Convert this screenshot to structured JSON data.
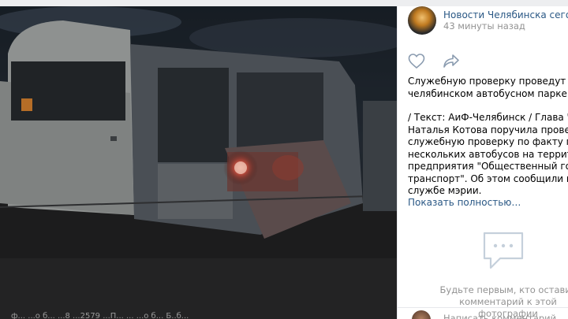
{
  "post": {
    "group_name": "Новости Челябинска сегодня,",
    "time": "43 минуты назад",
    "text_lines": [
      "Служебную проверку проведут из-за Ч",
      "челябинском автобусном парке",
      "",
      "/ Текст: АиФ-Челябинск / Глава Челябі",
      "Наталья Котова поручила провести",
      "служебную проверку по факту поврежд",
      "нескольких автобусов на территории",
      "предприятия \"Общественный городско",
      "транспорт\". Об этом сообщили в пресс",
      "службе мэрии."
    ],
    "show_more": "Показать полностью…"
  },
  "actions": {
    "like_icon": "heart-icon",
    "share_icon": "share-arrow-icon"
  },
  "comments": {
    "empty_line1": "Будьте первым, кто оставит",
    "empty_line2": "комментарий к этой фотографии",
    "placeholder": "Написать комментарий..."
  },
  "photo": {
    "caption": "ф...   ...о  б...   ...8  ...2579   ...П...   ...   ...о  б...   Б..б..."
  }
}
